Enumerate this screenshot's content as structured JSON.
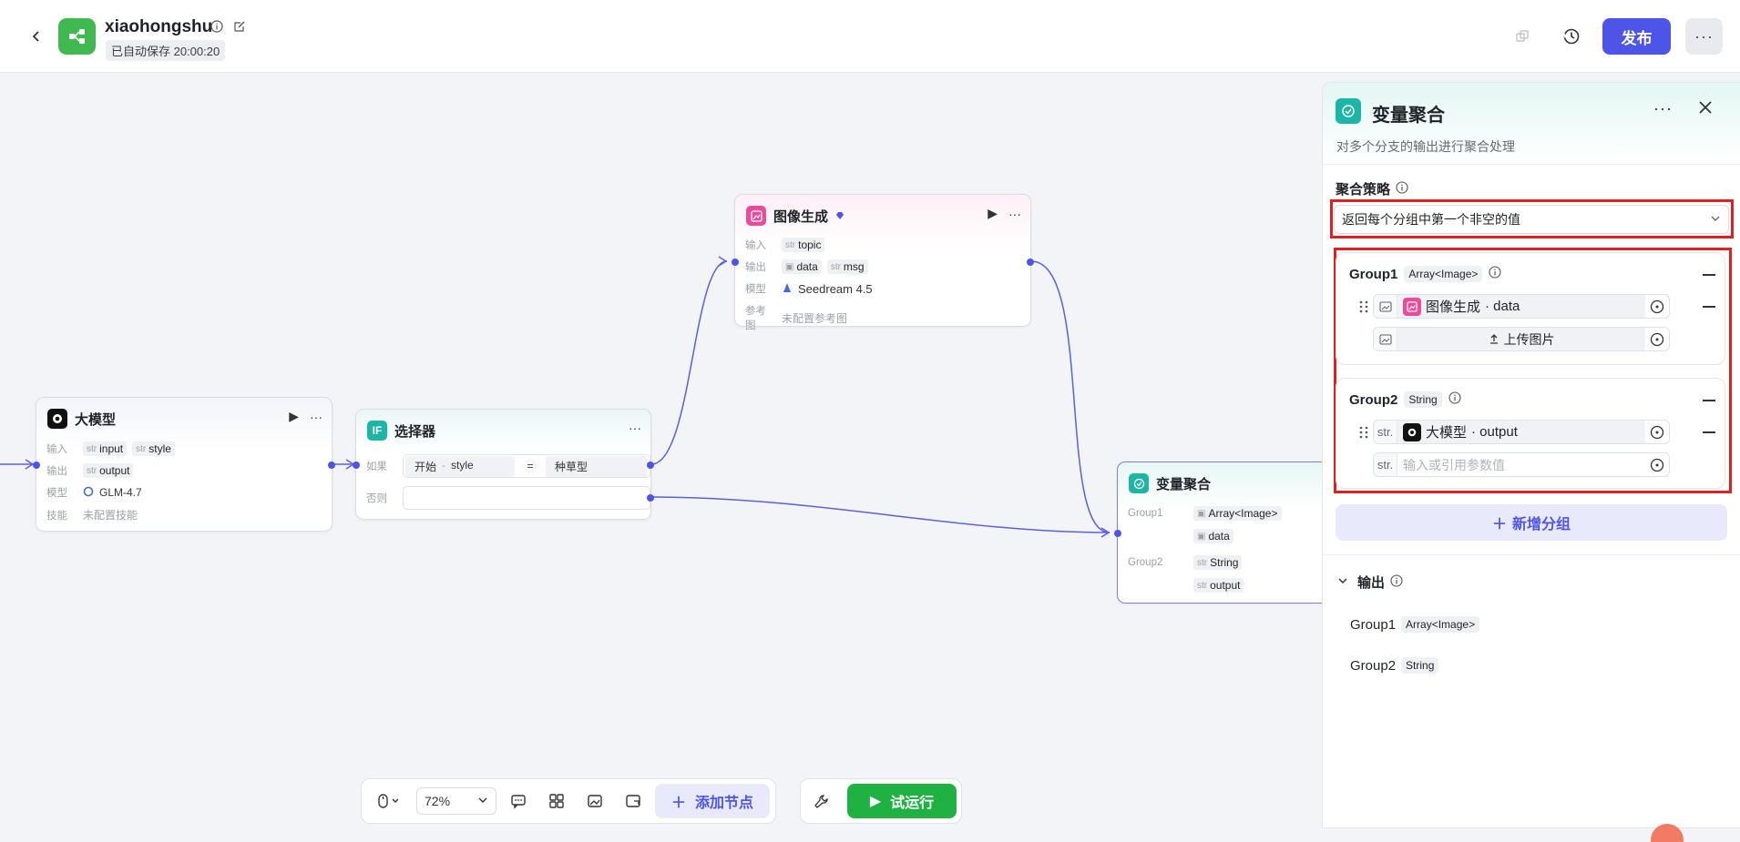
{
  "header": {
    "app_title": "xiaohongshu",
    "autosave": "已自动保存 20:00:20",
    "publish_label": "发布",
    "more_label": "···"
  },
  "nodes": {
    "llm": {
      "title": "大模型",
      "input_label": "输入",
      "inputs": [
        "input",
        "style"
      ],
      "output_label": "输出",
      "output": "output",
      "model_label": "模型",
      "model": "GLM-4.7",
      "skill_label": "技能",
      "skill": "未配置技能"
    },
    "selector": {
      "title": "选择器",
      "if_label": "如果",
      "left": "开始",
      "sep": "-",
      "field": "style",
      "op": "=",
      "value": "种草型",
      "else_label": "否则"
    },
    "imagegen": {
      "title": "图像生成",
      "input_label": "输入",
      "input": "topic",
      "output_label": "输出",
      "outputs": [
        "data",
        "msg"
      ],
      "model_label": "模型",
      "model": "Seedream 4.5",
      "ref_label": "参考图",
      "ref": "未配置参考图"
    },
    "aggregator": {
      "title": "变量聚合",
      "group1_label": "Group1",
      "group1_type": "Array<Image>",
      "group1_var": "data",
      "group2_label": "Group2",
      "group2_type": "String",
      "group2_var": "output"
    }
  },
  "panel": {
    "title": "变量聚合",
    "description": "对多个分支的输出进行聚合处理",
    "strategy_label": "聚合策略",
    "strategy_value": "返回每个分组中第一个非空的值",
    "groups": [
      {
        "name": "Group1",
        "type": "Array<Image>",
        "ref_node": "图像生成",
        "ref_var": "· data",
        "upload_label": "上传图片"
      },
      {
        "name": "Group2",
        "type": "String",
        "ref_prefix": "str.",
        "ref_node": "大模型",
        "ref_var": "· output",
        "placeholder": "输入或引用参数值"
      }
    ],
    "add_group_label": "新增分组",
    "output_label": "输出",
    "outputs": [
      {
        "name": "Group1",
        "type": "Array<Image>"
      },
      {
        "name": "Group2",
        "type": "String"
      }
    ]
  },
  "toolbar": {
    "zoom": "72%",
    "add_node_label": "添加节点",
    "run_label": "试运行"
  },
  "colors": {
    "accent": "#4e54e8",
    "run_green": "#1fb141",
    "highlight_red": "#e02020",
    "edge": "#5b5fe0"
  }
}
